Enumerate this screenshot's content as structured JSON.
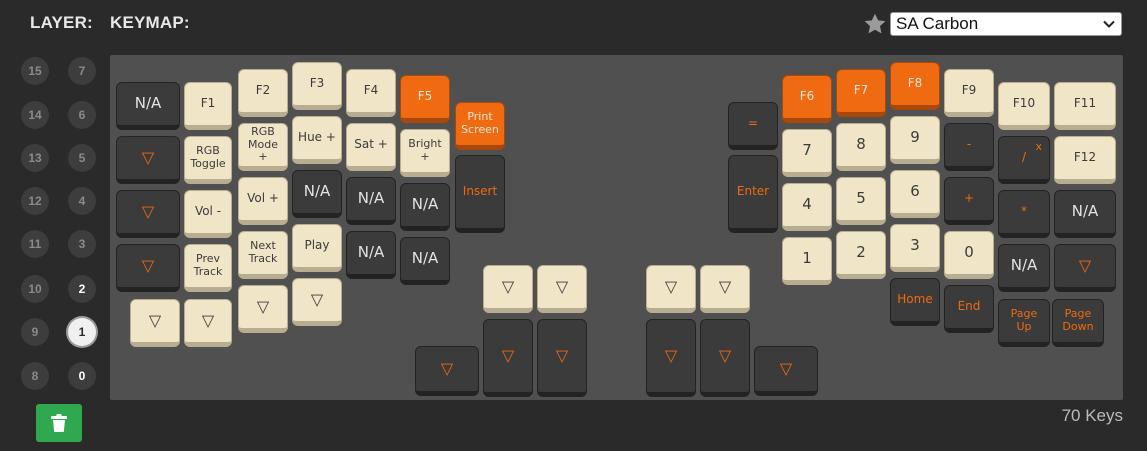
{
  "header": {
    "layer_label": "LAYER:",
    "keymap_label": "KEYMAP:"
  },
  "theme": {
    "selected": "SA Carbon",
    "star_icon": "star-icon"
  },
  "layers": [
    "15",
    "14",
    "13",
    "12",
    "11",
    "10",
    "9",
    "8",
    "7",
    "6",
    "5",
    "4",
    "3",
    "2",
    "1",
    "0"
  ],
  "footer": {
    "key_count": "70 Keys"
  },
  "colors": {
    "accent": "#ef6a10",
    "cream": "#f1e5c8",
    "dark_key": "#3b3b3b",
    "trash": "#2fa84f"
  },
  "keys": [
    {
      "id": "k0",
      "label": "N/A",
      "style": "d"
    },
    {
      "id": "k1",
      "label": "F1",
      "style": "c"
    },
    {
      "id": "k2",
      "label": "F2",
      "style": "c"
    },
    {
      "id": "k3",
      "label": "F3",
      "style": "c"
    },
    {
      "id": "k4",
      "label": "F4",
      "style": "c"
    },
    {
      "id": "k5",
      "label": "F5",
      "style": "o"
    },
    {
      "id": "k6",
      "label": "Print Screen",
      "style": "o"
    },
    {
      "id": "k7",
      "label": "▽",
      "style": "dt"
    },
    {
      "id": "k8",
      "label": "RGB Toggle",
      "style": "c"
    },
    {
      "id": "k9",
      "label": "RGB Mode +",
      "style": "c"
    },
    {
      "id": "k10",
      "label": "Hue +",
      "style": "c"
    },
    {
      "id": "k11",
      "label": "Sat +",
      "style": "c"
    },
    {
      "id": "k12",
      "label": "Bright +",
      "style": "c"
    },
    {
      "id": "k13",
      "label": "Insert",
      "style": "dt"
    },
    {
      "id": "k14",
      "label": "▽",
      "style": "dt"
    },
    {
      "id": "k15",
      "label": "Vol -",
      "style": "c"
    },
    {
      "id": "k16",
      "label": "Vol +",
      "style": "c"
    },
    {
      "id": "k17",
      "label": "N/A",
      "style": "d"
    },
    {
      "id": "k18",
      "label": "N/A",
      "style": "d"
    },
    {
      "id": "k19",
      "label": "N/A",
      "style": "d"
    },
    {
      "id": "k20",
      "label": "▽",
      "style": "dt"
    },
    {
      "id": "k21",
      "label": "Prev Track",
      "style": "c"
    },
    {
      "id": "k22",
      "label": "Next Track",
      "style": "c"
    },
    {
      "id": "k23",
      "label": "Play",
      "style": "c"
    },
    {
      "id": "k24",
      "label": "N/A",
      "style": "d"
    },
    {
      "id": "k25",
      "label": "N/A",
      "style": "d"
    },
    {
      "id": "k26",
      "label": "▽",
      "style": "c"
    },
    {
      "id": "k27",
      "label": "▽",
      "style": "c"
    },
    {
      "id": "k28",
      "label": "▽",
      "style": "c"
    },
    {
      "id": "k29",
      "label": "▽",
      "style": "c"
    },
    {
      "id": "k30",
      "label": "▽",
      "style": "c"
    },
    {
      "id": "k31",
      "label": "▽",
      "style": "c"
    },
    {
      "id": "k32",
      "label": "▽",
      "style": "dt"
    },
    {
      "id": "k33",
      "label": "▽",
      "style": "dt"
    },
    {
      "id": "k34",
      "label": "▽",
      "style": "dt"
    },
    {
      "id": "k35",
      "label": "▽",
      "style": "c"
    },
    {
      "id": "k36",
      "label": "▽",
      "style": "c"
    },
    {
      "id": "k37",
      "label": "▽",
      "style": "dt"
    },
    {
      "id": "k38",
      "label": "▽",
      "style": "dt"
    },
    {
      "id": "k39",
      "label": "▽",
      "style": "dt"
    },
    {
      "id": "k40",
      "label": "=",
      "style": "dt"
    },
    {
      "id": "k41",
      "label": "F6",
      "style": "o"
    },
    {
      "id": "k42",
      "label": "F7",
      "style": "o"
    },
    {
      "id": "k43",
      "label": "F8",
      "style": "o"
    },
    {
      "id": "k44",
      "label": "F9",
      "style": "c"
    },
    {
      "id": "k45",
      "label": "F10",
      "style": "c"
    },
    {
      "id": "k46",
      "label": "F11",
      "style": "c"
    },
    {
      "id": "k47",
      "label": "Enter",
      "style": "dt"
    },
    {
      "id": "k48",
      "label": "7",
      "style": "c"
    },
    {
      "id": "k49",
      "label": "8",
      "style": "c"
    },
    {
      "id": "k50",
      "label": "9",
      "style": "c"
    },
    {
      "id": "k51",
      "label": "-",
      "style": "dt"
    },
    {
      "id": "k52",
      "label": "/",
      "super": "x",
      "style": "dt"
    },
    {
      "id": "k53",
      "label": "F12",
      "style": "c"
    },
    {
      "id": "k54",
      "label": "4",
      "style": "c"
    },
    {
      "id": "k55",
      "label": "5",
      "style": "c"
    },
    {
      "id": "k56",
      "label": "6",
      "style": "c"
    },
    {
      "id": "k57",
      "label": "+",
      "style": "dt"
    },
    {
      "id": "k58",
      "label": "*",
      "style": "dt"
    },
    {
      "id": "k59",
      "label": "N/A",
      "style": "d"
    },
    {
      "id": "k60",
      "label": "1",
      "style": "c"
    },
    {
      "id": "k61",
      "label": "2",
      "style": "c"
    },
    {
      "id": "k62",
      "label": "3",
      "style": "c"
    },
    {
      "id": "k63",
      "label": "0",
      "style": "c"
    },
    {
      "id": "k64",
      "label": "N/A",
      "style": "d"
    },
    {
      "id": "k65",
      "label": "▽",
      "style": "dt"
    },
    {
      "id": "k66",
      "label": "Home",
      "style": "dt"
    },
    {
      "id": "k67",
      "label": "End",
      "style": "dt"
    },
    {
      "id": "k68",
      "label": "Page Up",
      "style": "dt"
    },
    {
      "id": "k69",
      "label": "Page Down",
      "style": "dt"
    }
  ]
}
